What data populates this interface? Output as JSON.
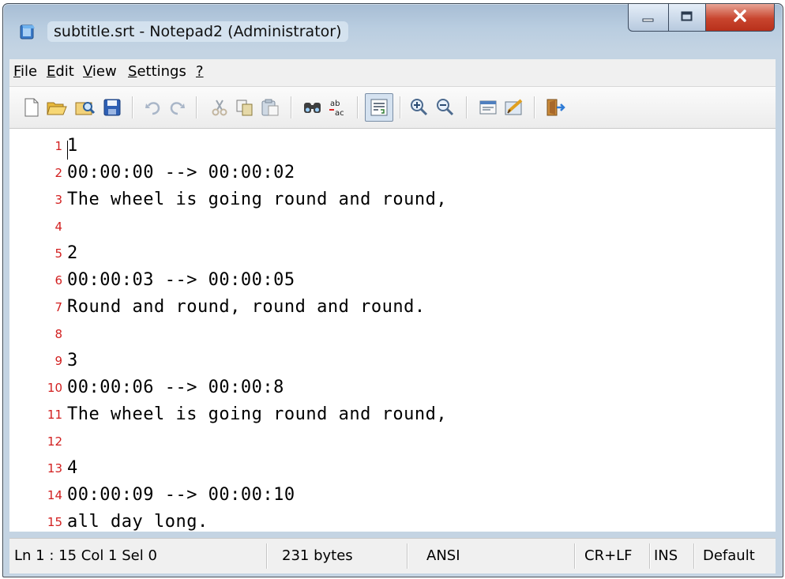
{
  "window": {
    "title": "subtitle.srt - Notepad2 (Administrator)"
  },
  "menu": [
    {
      "label": "File"
    },
    {
      "label": "Edit"
    },
    {
      "label": "View"
    },
    {
      "label": "Settings"
    },
    {
      "label": "?"
    }
  ],
  "toolbar": {
    "icons": [
      "new-file-icon",
      "open-folder-icon",
      "browse-icon",
      "save-icon",
      "undo-icon",
      "redo-icon",
      "cut-icon",
      "copy-icon",
      "paste-icon",
      "find-icon",
      "replace-icon",
      "word-wrap-icon",
      "zoom-in-icon",
      "zoom-out-icon",
      "select-scheme-icon",
      "customize-schemes-icon",
      "exit-icon"
    ],
    "word_wrap_active": true
  },
  "editor": {
    "lines": [
      {
        "num": "1",
        "text": "1"
      },
      {
        "num": "2",
        "text": "00:00:00 --> 00:00:02"
      },
      {
        "num": "3",
        "text": "The wheel is going round and round,"
      },
      {
        "num": "4",
        "text": ""
      },
      {
        "num": "5",
        "text": "2"
      },
      {
        "num": "6",
        "text": "00:00:03 --> 00:00:05"
      },
      {
        "num": "7",
        "text": "Round and round, round and round."
      },
      {
        "num": "8",
        "text": ""
      },
      {
        "num": "9",
        "text": "3"
      },
      {
        "num": "10",
        "text": "00:00:06 --> 00:00:8"
      },
      {
        "num": "11",
        "text": "The wheel is going round and round,"
      },
      {
        "num": "12",
        "text": ""
      },
      {
        "num": "13",
        "text": "4"
      },
      {
        "num": "14",
        "text": "00:00:09 --> 00:00:10"
      },
      {
        "num": "15",
        "text": "all day long."
      }
    ]
  },
  "status": {
    "position": "Ln 1 : 15   Col 1   Sel 0",
    "size": "231 bytes",
    "encoding": "ANSI",
    "line_endings": "CR+LF",
    "mode": "INS",
    "scheme": "Default"
  },
  "colors": {
    "line_number": "#d21f1f",
    "close_button": "#c8452e"
  }
}
